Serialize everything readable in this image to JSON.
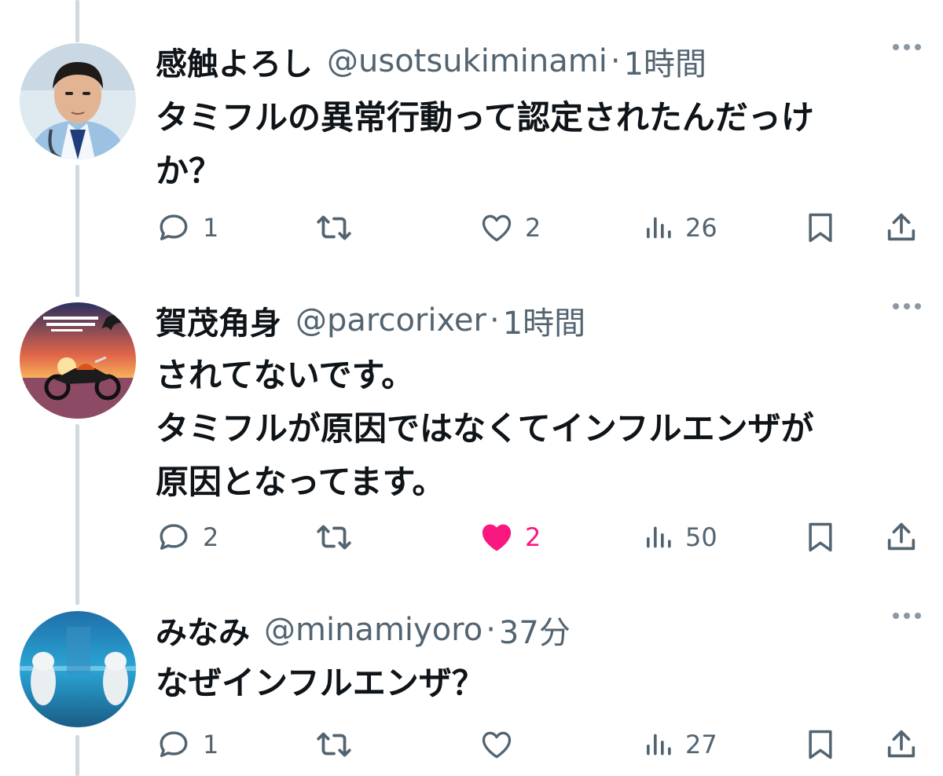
{
  "tweets": [
    {
      "name": "感触よろし",
      "handle": "@usotsukiminami",
      "separator": "·",
      "time": "1時間",
      "lines": [
        "タミフルの異常行動って認定されたんだっけ",
        "か？"
      ],
      "replies": "1",
      "retweets": "",
      "likes": "2",
      "liked": false,
      "views": "26"
    },
    {
      "name": "賀茂角身",
      "handle": "@parcorixer",
      "separator": "·",
      "time": "1時間",
      "lines": [
        "されてないです。",
        "タミフルが原因ではなくてインフルエンザが",
        "原因となってます。"
      ],
      "replies": "2",
      "retweets": "",
      "likes": "2",
      "liked": true,
      "views": "50"
    },
    {
      "name": "みなみ",
      "handle": "@minamiyoro",
      "separator": "·",
      "time": "37分",
      "lines": [
        "なぜインフルエンザ？"
      ],
      "replies": "1",
      "retweets": "",
      "likes": "",
      "liked": false,
      "views": "27"
    }
  ],
  "icons": {
    "reply": "reply-icon",
    "retweet": "retweet-icon",
    "like": "heart-icon",
    "views": "views-icon",
    "bookmark": "bookmark-icon",
    "share": "share-icon",
    "more": "more-icon"
  },
  "colors": {
    "text": "#0f1419",
    "secondary": "#536471",
    "like_active": "#f91880",
    "thread_line": "#cfd9de"
  }
}
